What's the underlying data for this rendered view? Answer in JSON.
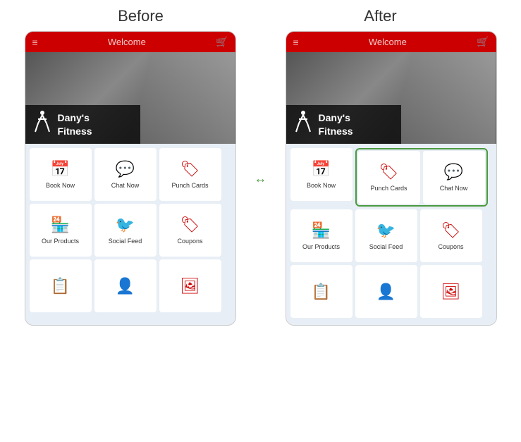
{
  "labels": {
    "before": "Before",
    "after": "After"
  },
  "header": {
    "hamburger": "≡",
    "title": "Welcome",
    "cart": "🛒"
  },
  "brand": {
    "line1": "Dany's",
    "line2": "Fitness"
  },
  "before_grid": [
    [
      {
        "label": "Book Now",
        "icon": "📅"
      },
      {
        "label": "Chat Now",
        "icon": "💬"
      },
      {
        "label": "Punch Cards",
        "icon": "🏷"
      }
    ],
    [
      {
        "label": "Our Products",
        "icon": "🏪"
      },
      {
        "label": "Social Feed",
        "icon": "🐦"
      },
      {
        "label": "Coupons",
        "icon": "🏷"
      }
    ],
    [
      {
        "label": "",
        "icon": "📋"
      },
      {
        "label": "",
        "icon": "👤"
      },
      {
        "label": "",
        "icon": "🖼"
      }
    ]
  ],
  "after_grid": [
    [
      {
        "label": "Book Now",
        "icon": "📅"
      },
      {
        "label": "Punch Cards",
        "icon": "🏷",
        "highlight": true
      },
      {
        "label": "Chat Now",
        "icon": "💬",
        "highlight": true
      }
    ],
    [
      {
        "label": "Our Products",
        "icon": "🏪"
      },
      {
        "label": "Social Feed",
        "icon": "🐦"
      },
      {
        "label": "Coupons",
        "icon": "🏷"
      }
    ],
    [
      {
        "label": "",
        "icon": "📋"
      },
      {
        "label": "",
        "icon": "👤"
      },
      {
        "label": "",
        "icon": "🖼"
      }
    ]
  ],
  "arrow": "↔"
}
